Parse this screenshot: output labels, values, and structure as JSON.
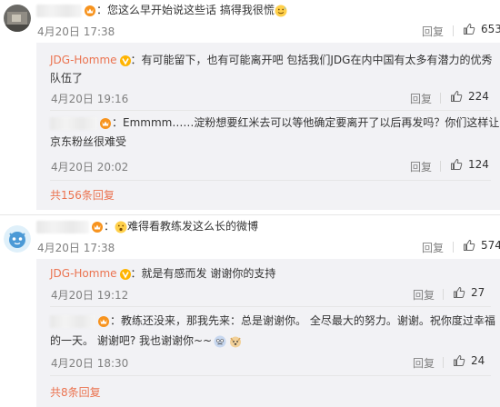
{
  "comments": [
    {
      "id": "c1",
      "text": "：您这么早开始说这些话 搞得我很慌",
      "time": "4月20日 17:38",
      "reply_label": "回复",
      "likes": "653"
    },
    {
      "id": "c1r1",
      "user": "JDG-Homme",
      "text": "：有可能留下，也有可能离开吧 包括我们JDG在内中国有太多有潜力的优秀",
      "text2": "队伍了",
      "time": "4月20日 19:16",
      "reply_label": "回复",
      "likes": "224"
    },
    {
      "id": "c1r2",
      "text": "：Emmmm……淀粉想要红米去可以等他确定要离开了以后再发吗？你们这样让",
      "text2": "京东粉丝很难受",
      "time": "4月20日 20:02",
      "reply_label": "回复",
      "likes": "124"
    },
    {
      "id": "c1more",
      "more_label": "共156条回复"
    },
    {
      "id": "c2",
      "text": "难得看教练发这么长的微博",
      "time": "4月20日 17:38",
      "reply_label": "回复",
      "likes": "574"
    },
    {
      "id": "c2r1",
      "user": "JDG-Homme",
      "text": "：就是有感而发 谢谢你的支持",
      "time": "4月20日 19:12",
      "reply_label": "回复",
      "likes": "27"
    },
    {
      "id": "c2r2",
      "text": "：教练还没来，那我先来：总是谢谢你。 全尽最大的努力。谢谢。祝你度过幸福",
      "text2": "的一天。 谢谢吧? 我也谢谢你~~",
      "time": "4月20日 18:30",
      "reply_label": "回复",
      "likes": "24"
    },
    {
      "id": "c2more",
      "more_label": "共8条回复"
    }
  ],
  "icons": {
    "like": "thumbs-up-icon",
    "verified": "verified-v-icon",
    "vip": "vip-crown-icon"
  },
  "colors": {
    "username": "#eb7350",
    "meta": "#808080",
    "nested_bg": "#f2f2f5",
    "text": "#333333"
  }
}
